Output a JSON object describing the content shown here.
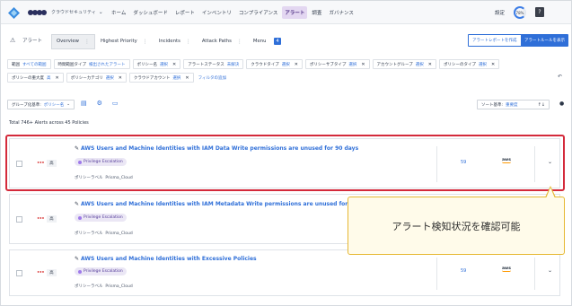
{
  "nav": {
    "org_name": "クラウドセキュリティ",
    "items": [
      "ホーム",
      "ダッシュボード",
      "レポート",
      "インベントリ",
      "コンプライアンス",
      "アラート",
      "調査",
      "ガバナンス"
    ],
    "active_index": 5,
    "settings_label": "設定",
    "score_label": "78%",
    "help_label": "?"
  },
  "page": {
    "title": "アラート",
    "tabs": [
      {
        "label": "Overview",
        "active": true
      },
      {
        "label": "Highest Priority",
        "active": false
      },
      {
        "label": "Incidents",
        "active": false
      },
      {
        "label": "Attack Paths",
        "active": false
      },
      {
        "label": "Menu",
        "active": false,
        "badge": "4"
      }
    ],
    "btn_report": "アラートレポートを作成",
    "btn_rules": "アラートルールを表示"
  },
  "filters": [
    {
      "key": "範囲",
      "value": "すべての範囲",
      "removable": false
    },
    {
      "key": "時間範囲タイプ",
      "value": "検出されたアラート",
      "removable": false
    },
    {
      "key": "ポリシー名",
      "value": "選択",
      "removable": true
    },
    {
      "key": "アラートステータス",
      "value": "未解決",
      "removable": false
    },
    {
      "key": "クラウドタイプ",
      "value": "選択",
      "removable": true
    },
    {
      "key": "ポリシーサブタイプ",
      "value": "選択",
      "removable": true
    },
    {
      "key": "アカウントグループ",
      "value": "選択",
      "removable": true
    },
    {
      "key": "ポリシーのタイプ",
      "value": "選択",
      "removable": true
    },
    {
      "key": "ポリシーの重大度",
      "value": "高",
      "removable": true
    },
    {
      "key": "ポリシーカテゴリ",
      "value": "選択",
      "removable": true
    },
    {
      "key": "クラウドアカウント",
      "value": "選択",
      "removable": true
    }
  ],
  "add_filter_label": "フィルタの追加",
  "group": {
    "key": "グループ化基準:",
    "value": "ポリシー名"
  },
  "sort": {
    "key": "ソート基準:",
    "value": "重要度",
    "arrows": "↑↓"
  },
  "total_text": "Total 746+ Alerts across 45 Policies",
  "alerts": [
    {
      "severity": "高",
      "title": "AWS Users and Machine Identities with IAM Data Write permissions are unused for 90 days",
      "tag": "Privilege Escalation",
      "policy_label": "ポリシーラベル",
      "policy_value": "Prisma_Cloud",
      "count": "59",
      "cloud": "aws"
    },
    {
      "severity": "高",
      "title": "AWS Users and Machine Identities with IAM Metadata Write permissions are unused for 90 d",
      "tag": "Privilege Escalation",
      "policy_label": "ポリシーラベル",
      "policy_value": "Prisma_Cloud",
      "count": "",
      "cloud": ""
    },
    {
      "severity": "高",
      "title": "AWS Users and Machine Identities with Excessive Policies",
      "tag": "Privilege Escalation",
      "policy_label": "ポリシーラベル",
      "policy_value": "Prisma_Cloud",
      "count": "59",
      "cloud": "aws"
    }
  ],
  "callout_text": "アラート検知状況を確認可能",
  "colors": {
    "accent": "#2f6fd8",
    "highlight": "#d42a3b",
    "callout_bg": "#fffbea",
    "callout_border": "#e6b832"
  }
}
